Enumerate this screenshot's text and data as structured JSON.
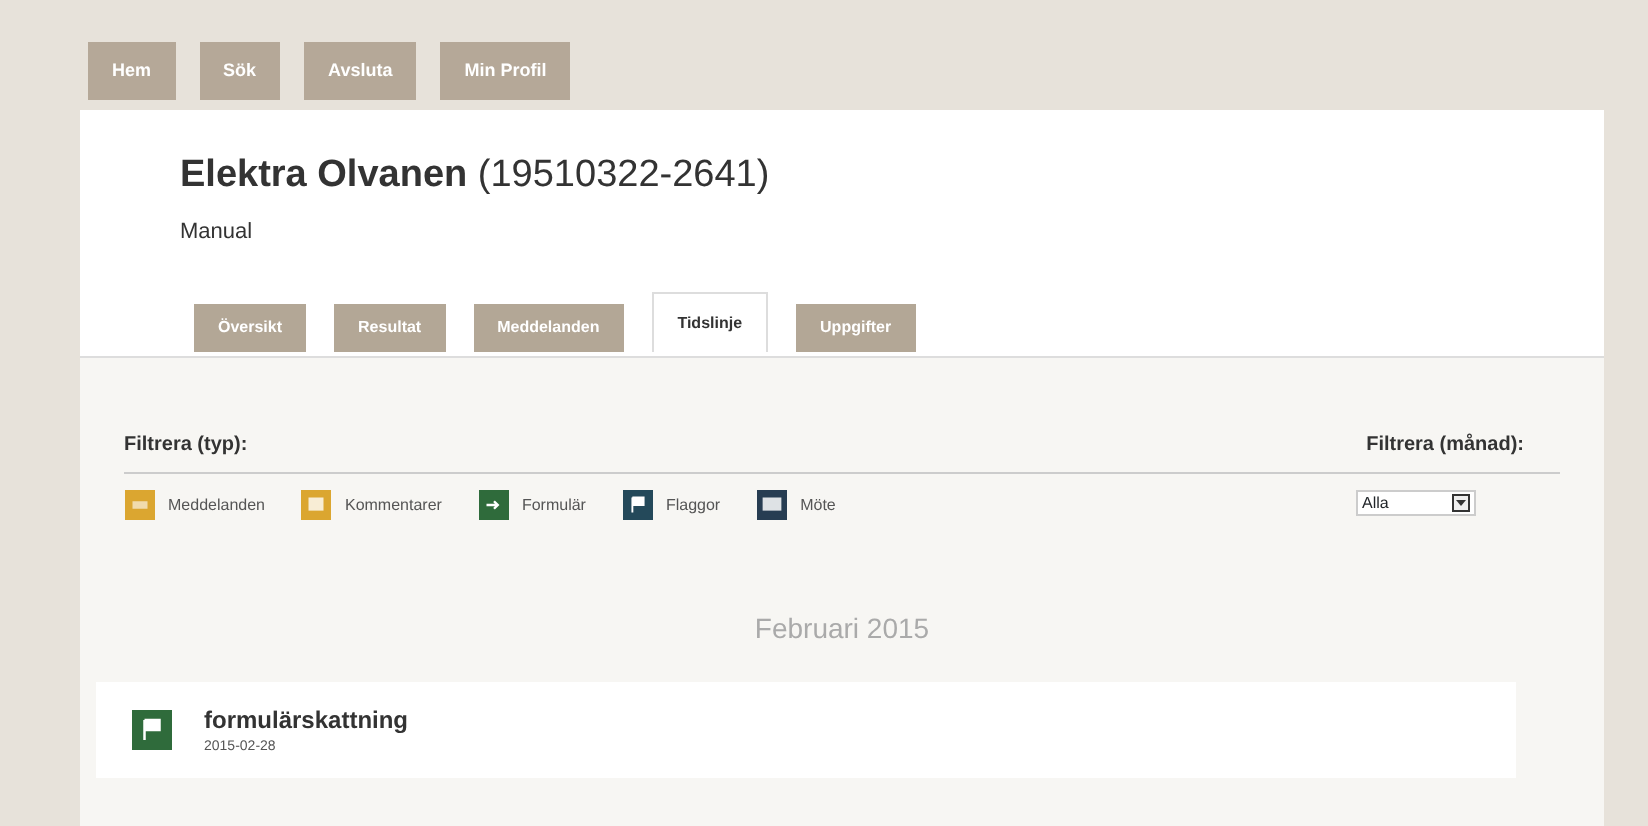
{
  "top_buttons": [
    "Hem",
    "Sök",
    "Avsluta",
    "Min Profil"
  ],
  "patient": {
    "name": "Elektra Olvanen",
    "id": "(19510322-2641)",
    "subtitle": "Manual"
  },
  "tabs": [
    {
      "label": "Översikt",
      "selected": false
    },
    {
      "label": "Resultat",
      "selected": false
    },
    {
      "label": "Meddelanden",
      "selected": false
    },
    {
      "label": "Tidslinje",
      "selected": true
    },
    {
      "label": "Uppgifter",
      "selected": false
    }
  ],
  "type_filter": {
    "label": "Filtrera (typ):",
    "items": [
      {
        "label": "Meddelanden",
        "color": "#dba630",
        "kind": "message"
      },
      {
        "label": "Kommentarer",
        "color": "#dba630",
        "kind": "comment"
      },
      {
        "label": "Formulär",
        "color": "#2f6b3b",
        "kind": "form"
      },
      {
        "label": "Flaggor",
        "color": "#24495a",
        "kind": "flag"
      },
      {
        "label": "Möte",
        "color": "#273d52",
        "kind": "meeting"
      }
    ]
  },
  "month_filter": {
    "label": "Filtrera (månad):",
    "value": "Alla"
  },
  "timeline": {
    "month": "Februari 2015",
    "entries": [
      {
        "title": "formulärskattning",
        "date": "2015-02-28",
        "kind": "flag",
        "color": "#2f6b3b"
      }
    ]
  }
}
